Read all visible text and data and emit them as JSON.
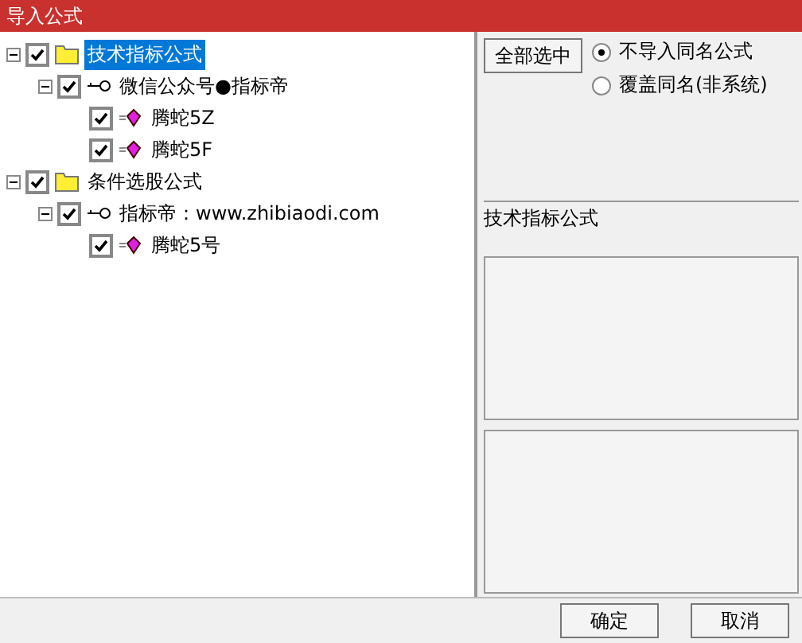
{
  "window": {
    "title": "导入公式"
  },
  "tree": [
    {
      "kind": "folder",
      "label": "技术指标公式",
      "checked": true,
      "selected": true,
      "expanded": true,
      "children": [
        {
          "kind": "key",
          "label": "微信公众号●指标帝",
          "checked": true,
          "selected": false,
          "expanded": true,
          "children": [
            {
              "kind": "gem",
              "label": "腾蛇5Z",
              "checked": true,
              "selected": false
            },
            {
              "kind": "gem",
              "label": "腾蛇5F",
              "checked": true,
              "selected": false
            }
          ]
        }
      ]
    },
    {
      "kind": "folder",
      "label": "条件选股公式",
      "checked": true,
      "selected": false,
      "expanded": true,
      "children": [
        {
          "kind": "key",
          "label": "指标帝：www.zhibiaodi.com",
          "checked": true,
          "selected": false,
          "expanded": true,
          "children": [
            {
              "kind": "gem",
              "label": "腾蛇5号",
              "checked": true,
              "selected": false
            }
          ]
        }
      ]
    }
  ],
  "select_all_button": "全部选中",
  "radios": [
    {
      "label": "不导入同名公式",
      "selected": true
    },
    {
      "label": "覆盖同名(非系统)",
      "selected": false
    }
  ],
  "info_label": "技术指标公式",
  "buttons": [
    "确定",
    "取消"
  ]
}
